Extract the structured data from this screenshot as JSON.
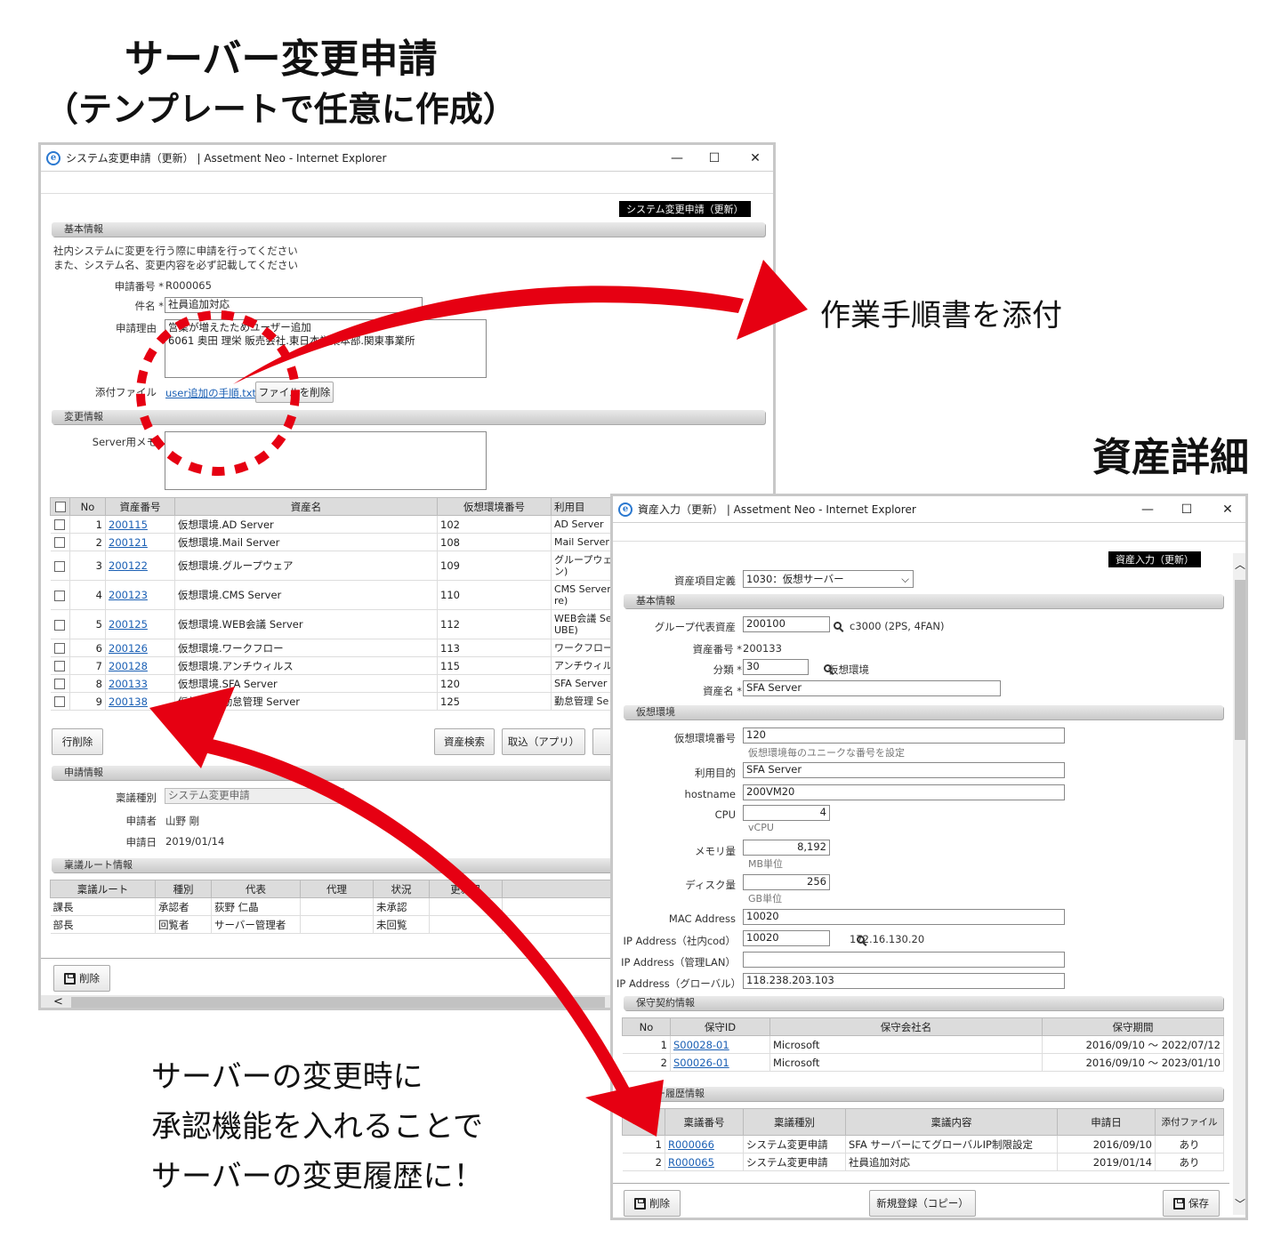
{
  "headings": {
    "main_title": "サーバー変更申請",
    "main_subtitle": "（テンプレートで任意に作成）",
    "asset_title": "資産詳細",
    "attach_note": "作業手順書を添付",
    "bottom_note": [
      "サーバーの変更時に",
      "承認機能を入れることで",
      "サーバーの変更履歴に！"
    ]
  },
  "w1": {
    "title": "システム変更申請（更新） | Assetment Neo - Internet Explorer",
    "tag": "システム変更申請（更新）",
    "section_basic": "基本情報",
    "desc1": "社内システムに変更を行う際に申請を行ってください",
    "desc2": "また、システム名、変更内容を必ず記載してください",
    "req_no_label": "申請番号",
    "req_no": "R000065",
    "subject_label": "件名",
    "subject": "社員追加対応",
    "reason_label": "申請理由",
    "reason1": "営業が増えたためユーザー追加",
    "reason2": "6061 奥田 理栄 販売会社.東日本営業本部.関東事業所",
    "attach_label": "添付ファイル",
    "attach_file": "user追加の手順.txt",
    "delete_file_btn": "ファイルを削除",
    "section_change": "変更情報",
    "server_memo_label": "Server用メモ",
    "assets_headers": [
      "No",
      "資産番号",
      "資産名",
      "仮想環境番号",
      "利用目"
    ],
    "assets": [
      {
        "no": "1",
        "id": "200115",
        "name": "仮想環境.AD Server",
        "venv": "102",
        "use": "AD Server"
      },
      {
        "no": "2",
        "id": "200121",
        "name": "仮想環境.Mail Server",
        "venv": "108",
        "use": "Mail Server"
      },
      {
        "no": "3",
        "id": "200122",
        "name": "仮想環境.グループウェア",
        "venv": "109",
        "use": "グループウェア",
        "use2": "ン)"
      },
      {
        "no": "4",
        "id": "200123",
        "name": "仮想環境.CMS Server",
        "venv": "110",
        "use": "CMS Server",
        "use2": "re)"
      },
      {
        "no": "5",
        "id": "200125",
        "name": "仮想環境.WEB会議 Server",
        "venv": "112",
        "use": "WEB会議 Se",
        "use2": "UBE)"
      },
      {
        "no": "6",
        "id": "200126",
        "name": "仮想環境.ワークフロー",
        "venv": "113",
        "use": "ワークフロー"
      },
      {
        "no": "7",
        "id": "200128",
        "name": "仮想環境.アンチウィルス",
        "venv": "115",
        "use": "アンチウィルス"
      },
      {
        "no": "8",
        "id": "200133",
        "name": "仮想環境.SFA Server",
        "venv": "120",
        "use": "SFA Server"
      },
      {
        "no": "9",
        "id": "200138",
        "name": "仮想環境.勤怠管理 Server",
        "venv": "125",
        "use": "勤怠管理 Se"
      }
    ],
    "row_delete_btn": "行削除",
    "asset_search_btn": "資産検索",
    "import_btn": "取込（アプリ）",
    "extra_btn": "取",
    "section_apply": "申請情報",
    "type_label": "稟議種別",
    "type_value": "システム変更申請",
    "applicant_label": "申請者",
    "applicant": "山野 剛",
    "date_label": "申請日",
    "date": "2019/01/14",
    "section_route": "稟議ルート情報",
    "route_headers": [
      "稟議ルート",
      "種別",
      "代表",
      "代理",
      "状況",
      "更新日"
    ],
    "routes": [
      {
        "route": "課長",
        "type": "承認者",
        "rep": "荻野 仁晶",
        "proxy": "",
        "status": "未承認",
        "date": ""
      },
      {
        "route": "部長",
        "type": "回覧者",
        "rep": "サーバー管理者",
        "proxy": "",
        "status": "未回覧",
        "date": ""
      }
    ],
    "delete_btn": "削除"
  },
  "w2": {
    "title": "資産入力（更新） | Assetment Neo - Internet Explorer",
    "tag": "資産入力（更新）",
    "def_label": "資産項目定義",
    "def_value": "1030：仮想サーバー",
    "section_basic": "基本情報",
    "group_label": "グループ代表資産",
    "group_value": "200100",
    "group_desc": "c3000 (2PS, 4FAN)",
    "asset_no_label": "資産番号",
    "asset_no": "200133",
    "class_label": "分類",
    "class_value": "30",
    "class_desc": "仮想環境",
    "name_label": "資産名",
    "name_value": "SFA Server",
    "section_venv": "仮想環境",
    "venv_label": "仮想環境番号",
    "venv_value": "120",
    "venv_hint": "仮想環境毎のユニークな番号を設定",
    "purpose_label": "利用目的",
    "purpose_value": "SFA Server",
    "hostname_label": "hostname",
    "hostname_value": "200VM20",
    "cpu_label": "CPU",
    "cpu_value": "4",
    "cpu_unit": "vCPU",
    "mem_label": "メモリ量",
    "mem_value": "8,192",
    "mem_unit": "MB単位",
    "disk_label": "ディスク量",
    "disk_value": "256",
    "disk_unit": "GB単位",
    "mac_label": "MAC Address",
    "mac_value": "10020",
    "ip1_label": "IP Address（社内cod）",
    "ip1_value": "10020",
    "ip1_desc": "172.16.130.20",
    "ip2_label": "IP Address（管理LAN）",
    "ip2_value": "",
    "ip3_label": "IP Address（グローバル）",
    "ip3_value": "118.238.203.103",
    "section_maint": "保守契約情報",
    "maint_headers": [
      "No",
      "保守ID",
      "保守会社名",
      "保守期間"
    ],
    "maint": [
      {
        "no": "1",
        "id": "S00028-01",
        "company": "Microsoft",
        "period": "2016/09/10 ～ 2022/07/12"
      },
      {
        "no": "2",
        "id": "S00026-01",
        "company": "Microsoft",
        "period": "2016/09/10 ～ 2023/01/10"
      }
    ],
    "section_flow": "フロー履歴情報",
    "flow_headers": [
      "No",
      "稟議番号",
      "稟議種別",
      "稟議内容",
      "申請日",
      "添付ファイル"
    ],
    "flows": [
      {
        "no": "1",
        "id": "R000066",
        "type": "システム変更申請",
        "content": "SFA サーバーにてグローバルIP制限設定",
        "date": "2016/09/10",
        "attach": "あり"
      },
      {
        "no": "2",
        "id": "R000065",
        "type": "システム変更申請",
        "content": "社員追加対応",
        "date": "2019/01/14",
        "attach": "あり"
      }
    ],
    "delete_btn": "削除",
    "copy_btn": "新規登録（コピー）",
    "save_btn": "保存"
  },
  "colors": {
    "arrow": "#e60012",
    "tag_bg": "#000000",
    "link": "#1a5fb4"
  }
}
